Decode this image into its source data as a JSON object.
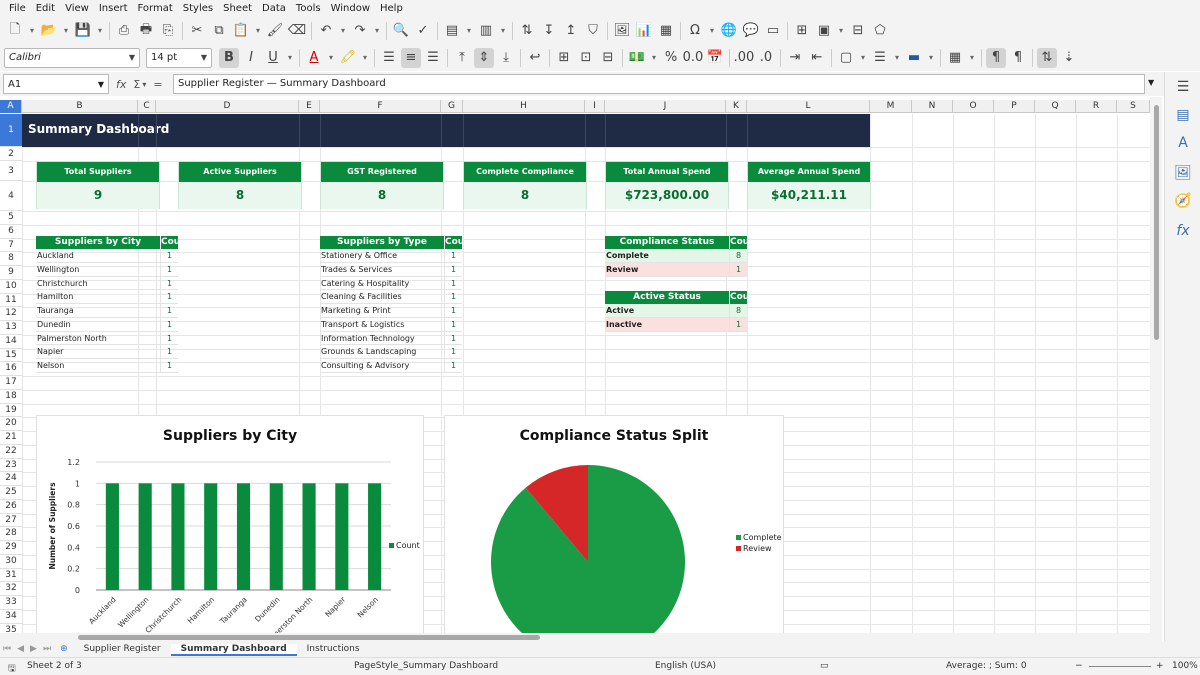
{
  "menu": [
    "File",
    "Edit",
    "View",
    "Insert",
    "Format",
    "Styles",
    "Sheet",
    "Data",
    "Tools",
    "Window",
    "Help"
  ],
  "toolbar": {
    "font_name": "Calibri",
    "font_size": "14 pt"
  },
  "formula": {
    "cell_ref": "A1",
    "content": "Supplier Register — Summary Dashboard"
  },
  "columns": [
    {
      "label": "A",
      "sel": true
    },
    {
      "label": "B"
    },
    {
      "label": "C"
    },
    {
      "label": "D"
    },
    {
      "label": "E"
    },
    {
      "label": "F"
    },
    {
      "label": "G"
    },
    {
      "label": "H"
    },
    {
      "label": "I"
    },
    {
      "label": "J"
    },
    {
      "label": "K"
    },
    {
      "label": "L"
    },
    {
      "label": "M"
    },
    {
      "label": "N"
    },
    {
      "label": "O"
    },
    {
      "label": "P"
    },
    {
      "label": "Q"
    },
    {
      "label": "R"
    },
    {
      "label": "S"
    }
  ],
  "rows": [
    "1",
    "2",
    "3",
    "4",
    "5",
    "6",
    "7",
    "8",
    "9",
    "10",
    "11",
    "12",
    "13",
    "14",
    "15",
    "16",
    "17",
    "18",
    "19",
    "20",
    "21",
    "22",
    "23",
    "24",
    "25",
    "26",
    "27",
    "28",
    "29",
    "30",
    "31",
    "32",
    "33",
    "34",
    "35"
  ],
  "dashboard": {
    "title": "Summary Dashboard",
    "kpis": [
      {
        "label": "Total Suppliers",
        "value": "9"
      },
      {
        "label": "Active Suppliers",
        "value": "8"
      },
      {
        "label": "GST Registered",
        "value": "8"
      },
      {
        "label": "Complete Compliance",
        "value": "8"
      },
      {
        "label": "Total Annual Spend",
        "value": "$723,800.00"
      },
      {
        "label": "Average Annual Spend",
        "value": "$40,211.11"
      }
    ],
    "by_city": {
      "header": "Suppliers by City",
      "count_header": "Count",
      "rows": [
        {
          "name": "Auckland",
          "count": "1"
        },
        {
          "name": "Wellington",
          "count": "1"
        },
        {
          "name": "Christchurch",
          "count": "1"
        },
        {
          "name": "Hamilton",
          "count": "1"
        },
        {
          "name": "Tauranga",
          "count": "1"
        },
        {
          "name": "Dunedin",
          "count": "1"
        },
        {
          "name": "Palmerston North",
          "count": "1"
        },
        {
          "name": "Napier",
          "count": "1"
        },
        {
          "name": "Nelson",
          "count": "1"
        }
      ]
    },
    "by_type": {
      "header": "Suppliers by Type",
      "count_header": "Count",
      "rows": [
        {
          "name": "Stationery & Office",
          "count": "1"
        },
        {
          "name": "Trades & Services",
          "count": "1"
        },
        {
          "name": "Catering & Hospitality",
          "count": "1"
        },
        {
          "name": "Cleaning & Facilities",
          "count": "1"
        },
        {
          "name": "Marketing & Print",
          "count": "1"
        },
        {
          "name": "Transport & Logistics",
          "count": "1"
        },
        {
          "name": "Information Technology",
          "count": "1"
        },
        {
          "name": "Grounds & Landscaping",
          "count": "1"
        },
        {
          "name": "Consulting & Advisory",
          "count": "1"
        }
      ]
    },
    "compliance": {
      "header": "Compliance Status",
      "count_header": "Count",
      "rows": [
        {
          "name": "Complete",
          "count": "8",
          "state": "ok"
        },
        {
          "name": "Review",
          "count": "1",
          "state": "bad"
        }
      ]
    },
    "active": {
      "header": "Active Status",
      "count_header": "Count",
      "rows": [
        {
          "name": "Active",
          "count": "8",
          "state": "ok"
        },
        {
          "name": "Inactive",
          "count": "1",
          "state": "bad"
        }
      ]
    }
  },
  "chart_data": [
    {
      "type": "bar",
      "title": "Suppliers by City",
      "ylabel": "Number of Suppliers",
      "xlabel": "",
      "categories": [
        "Auckland",
        "Wellington",
        "Christchurch",
        "Hamilton",
        "Tauranga",
        "Dunedin",
        "Palmerston North",
        "Napier",
        "Nelson"
      ],
      "series": [
        {
          "name": "Count",
          "values": [
            1,
            1,
            1,
            1,
            1,
            1,
            1,
            1,
            1
          ]
        }
      ],
      "ylim": [
        0,
        1.2
      ],
      "yticks": [
        "0",
        "0.2",
        "0.4",
        "0.6",
        "0.8",
        "1",
        "1.2"
      ],
      "color": "#0a8a3c",
      "legend": "right",
      "grid": true
    },
    {
      "type": "pie",
      "title": "Compliance Status Split",
      "slices": [
        {
          "label": "Complete",
          "value": 8,
          "color": "#1a9c47"
        },
        {
          "label": "Review",
          "value": 1,
          "color": "#d62728"
        }
      ],
      "legend": "right"
    }
  ],
  "tabs": [
    "Supplier Register",
    "Summary Dashboard",
    "Instructions"
  ],
  "status": {
    "sheet": "Sheet 2 of 3",
    "page_style": "PageStyle_Summary Dashboard",
    "language": "English (USA)",
    "summary": "Average: ; Sum: 0",
    "zoom": "100%"
  }
}
